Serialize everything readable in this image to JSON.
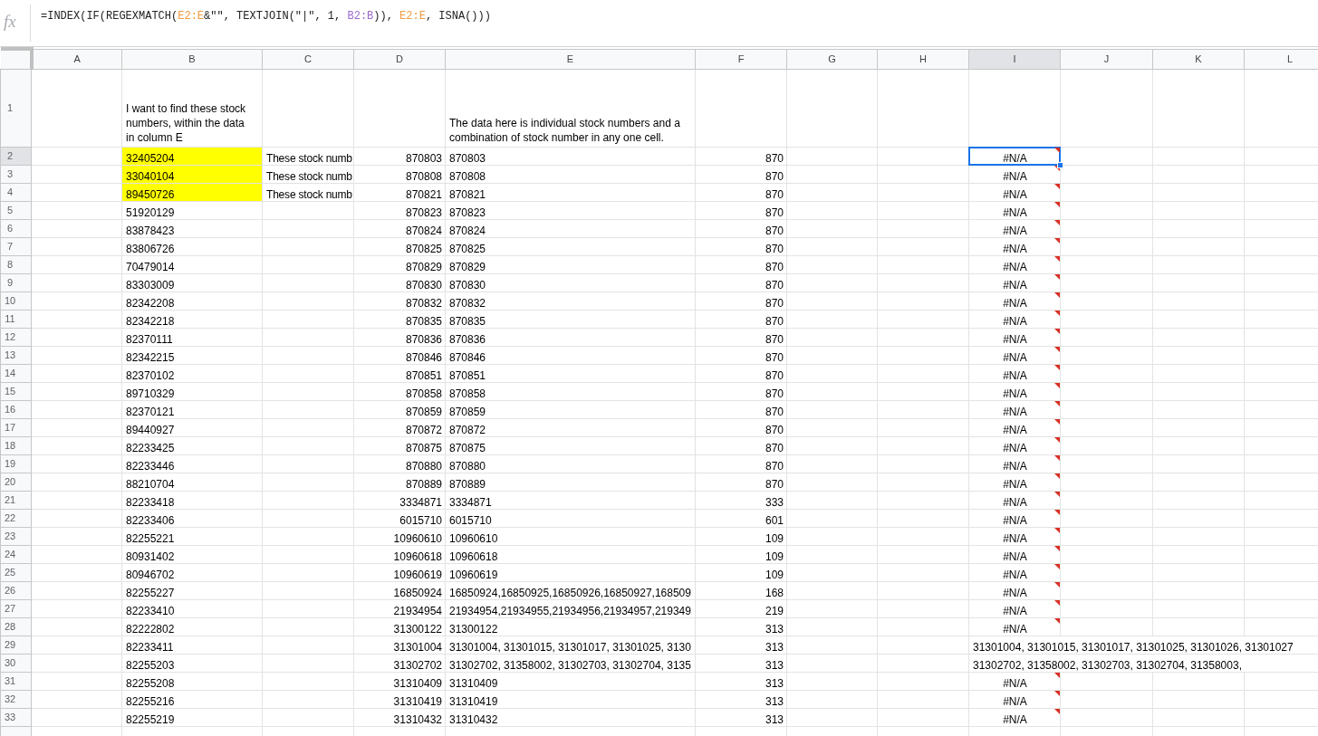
{
  "formula_bar": {
    "icon_label": "fx",
    "segments": [
      {
        "text": "=INDEX(IF(REGEXMATCH("
      },
      {
        "text": "E2:E",
        "color": "#f09a3e"
      },
      {
        "text": "&\"\", TEXTJOIN(\"|\", 1, "
      },
      {
        "text": "B2:B",
        "color": "#9c6ad0"
      },
      {
        "text": ")), "
      },
      {
        "text": "E2:E",
        "color": "#f09a3e"
      },
      {
        "text": ", ISNA()))"
      }
    ]
  },
  "columns": [
    {
      "label": "A",
      "selected": false
    },
    {
      "label": "B",
      "selected": false
    },
    {
      "label": "C",
      "selected": false
    },
    {
      "label": "D",
      "selected": false
    },
    {
      "label": "E",
      "selected": false
    },
    {
      "label": "F",
      "selected": false
    },
    {
      "label": "G",
      "selected": false
    },
    {
      "label": "H",
      "selected": false
    },
    {
      "label": "I",
      "selected": true
    },
    {
      "label": "J",
      "selected": false
    },
    {
      "label": "K",
      "selected": false
    },
    {
      "label": "L",
      "selected": false
    }
  ],
  "rows": [
    {
      "number": "1",
      "selected": false,
      "b": {
        "text": "I want to find these stock numbers, within the data in column E",
        "highlighted": false
      },
      "e": "The data here is individual stock numbers and a combination of stock number in any one cell."
    },
    {
      "number": "2",
      "selected": true,
      "b": {
        "text": "32405204",
        "highlighted": true
      },
      "c": "These stock numb",
      "d": "870803",
      "e": "870803",
      "f": "870",
      "i": {
        "text": "#N/A",
        "error": true,
        "selected": true
      }
    },
    {
      "number": "3",
      "selected": false,
      "b": {
        "text": "33040104",
        "highlighted": true
      },
      "c": "These stock numb",
      "d": "870808",
      "e": "870808",
      "f": "870",
      "i": {
        "text": "#N/A",
        "error": true,
        "selected": false
      }
    },
    {
      "number": "4",
      "selected": false,
      "b": {
        "text": "89450726",
        "highlighted": true
      },
      "c": "These stock numb",
      "d": "870821",
      "e": "870821",
      "f": "870",
      "i": {
        "text": "#N/A",
        "error": true,
        "selected": false
      }
    },
    {
      "number": "5",
      "selected": false,
      "b": {
        "text": "51920129",
        "highlighted": false
      },
      "d": "870823",
      "e": "870823",
      "f": "870",
      "i": {
        "text": "#N/A",
        "error": true,
        "selected": false
      }
    },
    {
      "number": "6",
      "selected": false,
      "b": {
        "text": "83878423",
        "highlighted": false
      },
      "d": "870824",
      "e": "870824",
      "f": "870",
      "i": {
        "text": "#N/A",
        "error": true,
        "selected": false
      }
    },
    {
      "number": "7",
      "selected": false,
      "b": {
        "text": "83806726",
        "highlighted": false
      },
      "d": "870825",
      "e": "870825",
      "f": "870",
      "i": {
        "text": "#N/A",
        "error": true,
        "selected": false
      }
    },
    {
      "number": "8",
      "selected": false,
      "b": {
        "text": "70479014",
        "highlighted": false
      },
      "d": "870829",
      "e": "870829",
      "f": "870",
      "i": {
        "text": "#N/A",
        "error": true,
        "selected": false
      }
    },
    {
      "number": "9",
      "selected": false,
      "b": {
        "text": "83303009",
        "highlighted": false
      },
      "d": "870830",
      "e": "870830",
      "f": "870",
      "i": {
        "text": "#N/A",
        "error": true,
        "selected": false
      }
    },
    {
      "number": "10",
      "selected": false,
      "b": {
        "text": "82342208",
        "highlighted": false
      },
      "d": "870832",
      "e": "870832",
      "f": "870",
      "i": {
        "text": "#N/A",
        "error": true,
        "selected": false
      }
    },
    {
      "number": "11",
      "selected": false,
      "b": {
        "text": "82342218",
        "highlighted": false
      },
      "d": "870835",
      "e": "870835",
      "f": "870",
      "i": {
        "text": "#N/A",
        "error": true,
        "selected": false
      }
    },
    {
      "number": "12",
      "selected": false,
      "b": {
        "text": "82370111",
        "highlighted": false
      },
      "d": "870836",
      "e": "870836",
      "f": "870",
      "i": {
        "text": "#N/A",
        "error": true,
        "selected": false
      }
    },
    {
      "number": "13",
      "selected": false,
      "b": {
        "text": "82342215",
        "highlighted": false
      },
      "d": "870846",
      "e": "870846",
      "f": "870",
      "i": {
        "text": "#N/A",
        "error": true,
        "selected": false
      }
    },
    {
      "number": "14",
      "selected": false,
      "b": {
        "text": "82370102",
        "highlighted": false
      },
      "d": "870851",
      "e": "870851",
      "f": "870",
      "i": {
        "text": "#N/A",
        "error": true,
        "selected": false
      }
    },
    {
      "number": "15",
      "selected": false,
      "b": {
        "text": "89710329",
        "highlighted": false
      },
      "d": "870858",
      "e": "870858",
      "f": "870",
      "i": {
        "text": "#N/A",
        "error": true,
        "selected": false
      }
    },
    {
      "number": "16",
      "selected": false,
      "b": {
        "text": "82370121",
        "highlighted": false
      },
      "d": "870859",
      "e": "870859",
      "f": "870",
      "i": {
        "text": "#N/A",
        "error": true,
        "selected": false
      }
    },
    {
      "number": "17",
      "selected": false,
      "b": {
        "text": "89440927",
        "highlighted": false
      },
      "d": "870872",
      "e": "870872",
      "f": "870",
      "i": {
        "text": "#N/A",
        "error": true,
        "selected": false
      }
    },
    {
      "number": "18",
      "selected": false,
      "b": {
        "text": "82233425",
        "highlighted": false
      },
      "d": "870875",
      "e": "870875",
      "f": "870",
      "i": {
        "text": "#N/A",
        "error": true,
        "selected": false
      }
    },
    {
      "number": "19",
      "selected": false,
      "b": {
        "text": "82233446",
        "highlighted": false
      },
      "d": "870880",
      "e": "870880",
      "f": "870",
      "i": {
        "text": "#N/A",
        "error": true,
        "selected": false
      }
    },
    {
      "number": "20",
      "selected": false,
      "b": {
        "text": "88210704",
        "highlighted": false
      },
      "d": "870889",
      "e": "870889",
      "f": "870",
      "i": {
        "text": "#N/A",
        "error": true,
        "selected": false
      }
    },
    {
      "number": "21",
      "selected": false,
      "b": {
        "text": "82233418",
        "highlighted": false
      },
      "d": "3334871",
      "e": "3334871",
      "f": "333",
      "i": {
        "text": "#N/A",
        "error": true,
        "selected": false
      }
    },
    {
      "number": "22",
      "selected": false,
      "b": {
        "text": "82233406",
        "highlighted": false
      },
      "d": "6015710",
      "e": "6015710",
      "f": "601",
      "i": {
        "text": "#N/A",
        "error": true,
        "selected": false
      }
    },
    {
      "number": "23",
      "selected": false,
      "b": {
        "text": "82255221",
        "highlighted": false
      },
      "d": "10960610",
      "e": "10960610",
      "f": "109",
      "i": {
        "text": "#N/A",
        "error": true,
        "selected": false
      }
    },
    {
      "number": "24",
      "selected": false,
      "b": {
        "text": "80931402",
        "highlighted": false
      },
      "d": "10960618",
      "e": "10960618",
      "f": "109",
      "i": {
        "text": "#N/A",
        "error": true,
        "selected": false
      }
    },
    {
      "number": "25",
      "selected": false,
      "b": {
        "text": "80946702",
        "highlighted": false
      },
      "d": "10960619",
      "e": "10960619",
      "f": "109",
      "i": {
        "text": "#N/A",
        "error": true,
        "selected": false
      }
    },
    {
      "number": "26",
      "selected": false,
      "b": {
        "text": "82255227",
        "highlighted": false
      },
      "d": "16850924",
      "e": "16850924,16850925,16850926,16850927,168509",
      "f": "168",
      "i": {
        "text": "#N/A",
        "error": true,
        "selected": false
      }
    },
    {
      "number": "27",
      "selected": false,
      "b": {
        "text": "82233410",
        "highlighted": false
      },
      "d": "21934954",
      "e": "21934954,21934955,21934956,21934957,219349",
      "f": "219",
      "i": {
        "text": "#N/A",
        "error": true,
        "selected": false
      }
    },
    {
      "number": "28",
      "selected": false,
      "b": {
        "text": "82222802",
        "highlighted": false
      },
      "d": "31300122",
      "e": "31300122",
      "f": "313",
      "i": {
        "text": "#N/A",
        "error": true,
        "selected": false
      }
    },
    {
      "number": "29",
      "selected": false,
      "b": {
        "text": "82233411",
        "highlighted": false
      },
      "d": "31301004",
      "e": "31301004, 31301015, 31301017, 31301025, 3130",
      "f": "313",
      "i": {
        "text": "31301004, 31301015, 31301017, 31301025, 31301026, 31301027",
        "error": false,
        "selected": false
      }
    },
    {
      "number": "30",
      "selected": false,
      "b": {
        "text": "82255203",
        "highlighted": false
      },
      "d": "31302702",
      "e": "31302702, 31358002, 31302703, 31302704, 3135",
      "f": "313",
      "i": {
        "text": "31302702, 31358002, 31302703, 31302704, 31358003,",
        "error": false,
        "selected": false
      }
    },
    {
      "number": "31",
      "selected": false,
      "b": {
        "text": "82255208",
        "highlighted": false
      },
      "d": "31310409",
      "e": "31310409",
      "f": "313",
      "i": {
        "text": "#N/A",
        "error": true,
        "selected": false
      }
    },
    {
      "number": "32",
      "selected": false,
      "b": {
        "text": "82255216",
        "highlighted": false
      },
      "d": "31310419",
      "e": "31310419",
      "f": "313",
      "i": {
        "text": "#N/A",
        "error": true,
        "selected": false
      }
    },
    {
      "number": "33",
      "selected": false,
      "b": {
        "text": "82255219",
        "highlighted": false
      },
      "d": "31310432",
      "e": "31310432",
      "f": "313",
      "i": {
        "text": "#N/A",
        "error": true,
        "selected": false
      }
    }
  ]
}
